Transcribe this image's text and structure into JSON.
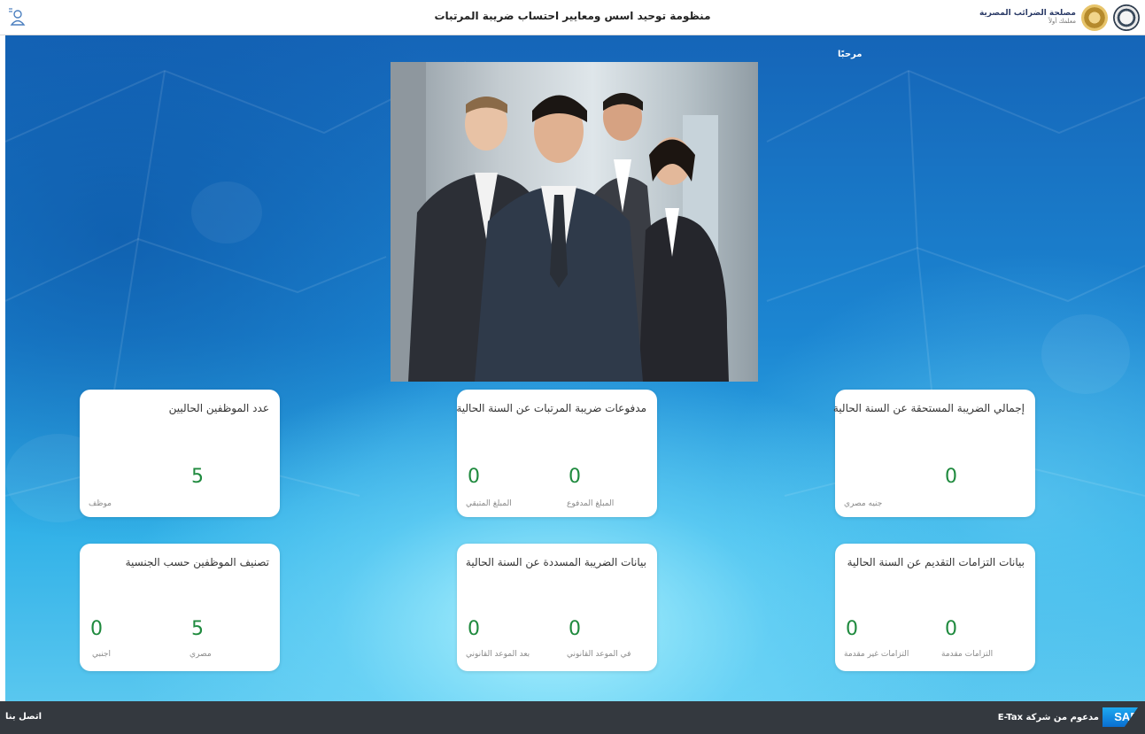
{
  "header": {
    "title": "منظومة توحيد اسس ومعايير احتساب ضريبة المرتبات",
    "brand_name": "مصلحة الضرائب المصرية",
    "brand_sub": "معلمك أولاً",
    "user_icon": "user-menu-icon"
  },
  "main": {
    "welcome": "مرحبًا"
  },
  "cards": {
    "total_tax": {
      "title": "إجمالي الضريبة المستحقة عن السنة الحالية",
      "value": "0",
      "unit": "جنيه مصري"
    },
    "payments": {
      "title": "مدفوعات ضريبة المرتبات عن السنة الحالية",
      "paid_value": "0",
      "paid_label": "المبلغ المدفوع",
      "remaining_value": "0",
      "remaining_label": "المبلغ المتبقي"
    },
    "employees": {
      "title": "عدد الموظفين الحاليين",
      "value": "5",
      "unit": "موظف"
    },
    "obligations": {
      "title": "بيانات التزامات التقديم عن السنة الحالية",
      "submitted_value": "0",
      "submitted_label": "التزامات مقدمة",
      "unsubmitted_value": "0",
      "unsubmitted_label": "التزامات غير مقدمة"
    },
    "paid_tax": {
      "title": "بيانات الضريبة المسددة عن السنة الحالية",
      "ontime_value": "0",
      "ontime_label": "في الموعد القانوني",
      "late_value": "0",
      "late_label": "بعد الموعد القانوني"
    },
    "nationality": {
      "title": "تصنيف الموظفين حسب الجنسية",
      "egyptian_value": "5",
      "egyptian_label": "مصري",
      "foreign_value": "0",
      "foreign_label": "اجنبي"
    }
  },
  "footer": {
    "contact": "اتصل بنا",
    "sap_logo": "SAP",
    "powered": "مدعوم من شركة E-Tax"
  },
  "colors": {
    "value_green": "#1f8a3e",
    "footer_bg": "#34393f",
    "bg_blue": "#1c86d2"
  }
}
